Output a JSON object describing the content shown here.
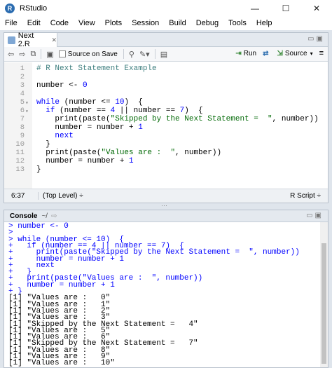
{
  "window": {
    "title": "RStudio",
    "controls": [
      "—",
      "☐",
      "✕"
    ]
  },
  "menu": [
    "File",
    "Edit",
    "Code",
    "View",
    "Plots",
    "Session",
    "Build",
    "Debug",
    "Tools",
    "Help"
  ],
  "editor": {
    "tab_label": "Next 2.R",
    "source_on_save": "Source on Save",
    "run_label": "Run",
    "source_label": "Source",
    "line_numbers": [
      "1",
      "2",
      "3",
      "4",
      "5",
      "6",
      "7",
      "8",
      "9",
      "10",
      "11",
      "12",
      "13"
    ],
    "lines": [
      [
        {
          "t": "# R Next Statement Example",
          "c": "cm"
        }
      ],
      [],
      [
        {
          "t": "number <- ",
          "c": "plain"
        },
        {
          "t": "0",
          "c": "num"
        }
      ],
      [],
      [
        {
          "t": "while",
          "c": "kw"
        },
        {
          "t": " (number <= ",
          "c": "plain"
        },
        {
          "t": "10",
          "c": "num"
        },
        {
          "t": ")  {",
          "c": "plain"
        }
      ],
      [
        {
          "t": "  ",
          "c": "plain"
        },
        {
          "t": "if",
          "c": "kw"
        },
        {
          "t": " (number == ",
          "c": "plain"
        },
        {
          "t": "4",
          "c": "num"
        },
        {
          "t": " || number == ",
          "c": "plain"
        },
        {
          "t": "7",
          "c": "num"
        },
        {
          "t": ")  {",
          "c": "plain"
        }
      ],
      [
        {
          "t": "    print(paste(",
          "c": "plain"
        },
        {
          "t": "\"Skipped by the Next Statement =  \"",
          "c": "str"
        },
        {
          "t": ", number))",
          "c": "plain"
        }
      ],
      [
        {
          "t": "    number = number + ",
          "c": "plain"
        },
        {
          "t": "1",
          "c": "num"
        }
      ],
      [
        {
          "t": "    ",
          "c": "plain"
        },
        {
          "t": "next",
          "c": "kw"
        }
      ],
      [
        {
          "t": "  }",
          "c": "plain"
        }
      ],
      [
        {
          "t": "  print(paste(",
          "c": "plain"
        },
        {
          "t": "\"Values are :  \"",
          "c": "str"
        },
        {
          "t": ", number))",
          "c": "plain"
        }
      ],
      [
        {
          "t": "  number = number + ",
          "c": "plain"
        },
        {
          "t": "1",
          "c": "num"
        }
      ],
      [
        {
          "t": "}",
          "c": "plain"
        }
      ]
    ],
    "status_position": "6:37",
    "status_scope": "(Top Level) ÷",
    "status_language": "R Script ÷"
  },
  "console": {
    "title": "Console",
    "path": "~/",
    "lines": [
      {
        "t": "> number <- 0",
        "k": "input"
      },
      {
        "t": ">",
        "k": "input"
      },
      {
        "t": "> while (number <= 10)  {",
        "k": "input"
      },
      {
        "t": "+   if (number == 4 || number == 7)  {",
        "k": "input"
      },
      {
        "t": "+     print(paste(\"Skipped by the Next Statement =  \", number))",
        "k": "input"
      },
      {
        "t": "+     number = number + 1",
        "k": "input"
      },
      {
        "t": "+     next",
        "k": "input"
      },
      {
        "t": "+   }",
        "k": "input"
      },
      {
        "t": "+   print(paste(\"Values are :  \", number))",
        "k": "input"
      },
      {
        "t": "+   number = number + 1",
        "k": "input"
      },
      {
        "t": "+ }",
        "k": "input"
      },
      {
        "t": "[1] \"Values are :   0\"",
        "k": "output"
      },
      {
        "t": "[1] \"Values are :   1\"",
        "k": "output"
      },
      {
        "t": "[1] \"Values are :   2\"",
        "k": "output"
      },
      {
        "t": "[1] \"Values are :   3\"",
        "k": "output"
      },
      {
        "t": "[1] \"Skipped by the Next Statement =   4\"",
        "k": "output"
      },
      {
        "t": "[1] \"Values are :   5\"",
        "k": "output"
      },
      {
        "t": "[1] \"Values are :   6\"",
        "k": "output"
      },
      {
        "t": "[1] \"Skipped by the Next Statement =   7\"",
        "k": "output"
      },
      {
        "t": "[1] \"Values are :   8\"",
        "k": "output"
      },
      {
        "t": "[1] \"Values are :   9\"",
        "k": "output"
      },
      {
        "t": "[1] \"Values are :   10\"",
        "k": "output"
      }
    ]
  }
}
